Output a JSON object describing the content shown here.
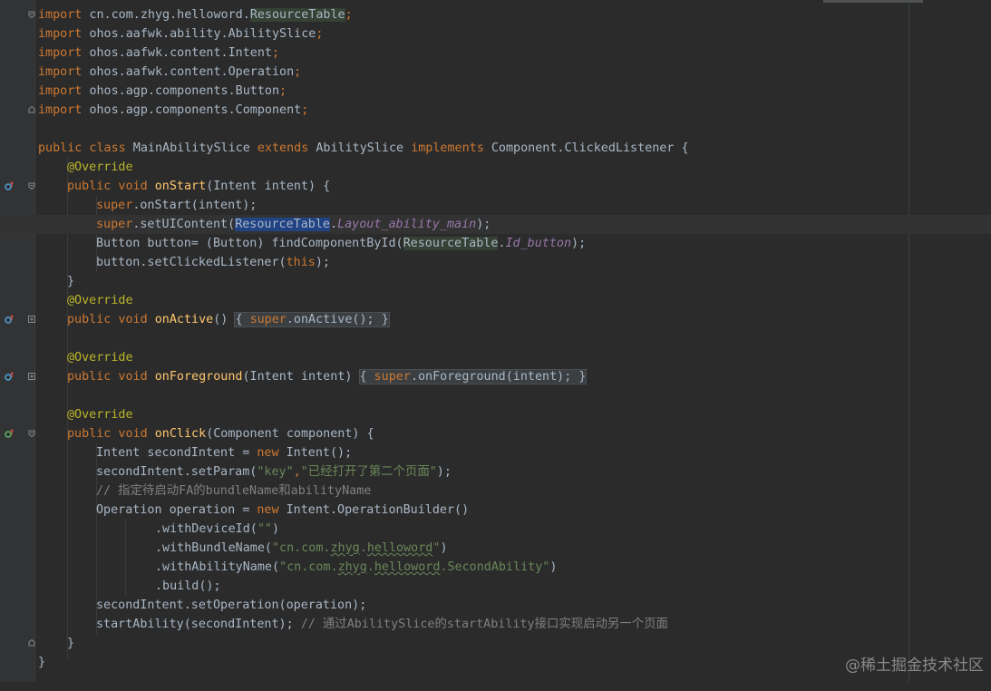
{
  "imports": [
    {
      "keyword": "import",
      "path": "cn.com.zhyg.helloword.",
      "cls": "ResourceTable",
      "semi": ";"
    },
    {
      "keyword": "import",
      "path": "ohos.aafwk.ability.AbilitySlice",
      "cls": "",
      "semi": ";"
    },
    {
      "keyword": "import",
      "path": "ohos.aafwk.content.Intent",
      "cls": "",
      "semi": ";"
    },
    {
      "keyword": "import",
      "path": "ohos.aafwk.content.Operation",
      "cls": "",
      "semi": ";"
    },
    {
      "keyword": "import",
      "path": "ohos.agp.components.Button",
      "cls": "",
      "semi": ";"
    },
    {
      "keyword": "import",
      "path": "ohos.agp.components.Component",
      "cls": "",
      "semi": ";"
    }
  ],
  "class_decl": {
    "kw1": "public class",
    "name": " MainAbilitySlice ",
    "kw2": "extends",
    "base": " AbilitySlice ",
    "kw3": "implements",
    "iface": " Component.ClickedListener {"
  },
  "override": "@Override",
  "onStart": {
    "kw": "public void ",
    "name": "onStart",
    "params": "(Intent intent) {",
    "l1_super": "super",
    "l1_rest": ".onStart(intent);",
    "l2_super": "super",
    "l2_a": ".setUIContent(",
    "l2_cls": "ResourceTable",
    "l2_dot": ".",
    "l2_field": "Layout_ability_main",
    "l2_end": ");",
    "l3_a": "Button button= (Button) findComponentById(",
    "l3_cls": "ResourceTable",
    "l3_dot": ".",
    "l3_field": "Id_button",
    "l3_end": ");",
    "l4_a": "button.setClickedListener(",
    "l4_kw": "this",
    "l4_end": ");",
    "close": "}"
  },
  "onActive": {
    "kw": "public void ",
    "name": "onActive",
    "params": "() ",
    "body_open": "{ ",
    "super": "super",
    "rest": ".onActive(); ",
    "close": "}"
  },
  "onForeground": {
    "kw": "public void ",
    "name": "onForeground",
    "params": "(Intent intent) ",
    "body_open": "{ ",
    "super": "super",
    "rest": ".onForeground(intent); ",
    "close": "}"
  },
  "onClick": {
    "kw": "public void ",
    "name": "onClick",
    "params": "(Component component) {",
    "l1_a": "Intent secondIntent = ",
    "l1_kw": "new",
    "l1_b": " Intent();",
    "l2_a": "secondIntent.setParam(",
    "l2_s1": "\"key\"",
    "l2_comma": ",",
    "l2_s2": "\"已经打开了第二个页面\"",
    "l2_end": ");",
    "l3_cmt": "// 指定待启动FA的bundleName和abilityName",
    "l4_a": "Operation operation = ",
    "l4_kw": "new",
    "l4_b": " Intent.OperationBuilder()",
    "l5_a": ".withDeviceId(",
    "l5_s": "\"\"",
    "l5_end": ")",
    "l6_a": ".withBundleName(",
    "l6_s1": "\"cn.com.",
    "l6_u1": "zhyg",
    "l6_s2": ".",
    "l6_u2": "helloword",
    "l6_s3": "\"",
    "l6_end": ")",
    "l7_a": ".withAbilityName(",
    "l7_s1": "\"cn.com.",
    "l7_u1": "zhyg",
    "l7_s2": ".",
    "l7_u2": "helloword",
    "l7_s3": ".SecondAbility\"",
    "l7_end": ")",
    "l8_a": ".build();",
    "l9_a": "secondIntent.setOperation(operation);",
    "l10_a": "startAbility(secondIntent); ",
    "l10_cmt": "// 通过AbilitySlice的startAbility接口实现启动另一个页面",
    "close": "}"
  },
  "class_close": "}",
  "watermark": "@稀土掘金技术社区",
  "colors": {
    "background": "#2b2b2b",
    "keyword": "#cc7832",
    "annotation": "#bbb529",
    "string": "#6a8759",
    "method": "#ffc66d",
    "field": "#9876aa",
    "comment": "#808080",
    "text": "#a9b7c6"
  }
}
